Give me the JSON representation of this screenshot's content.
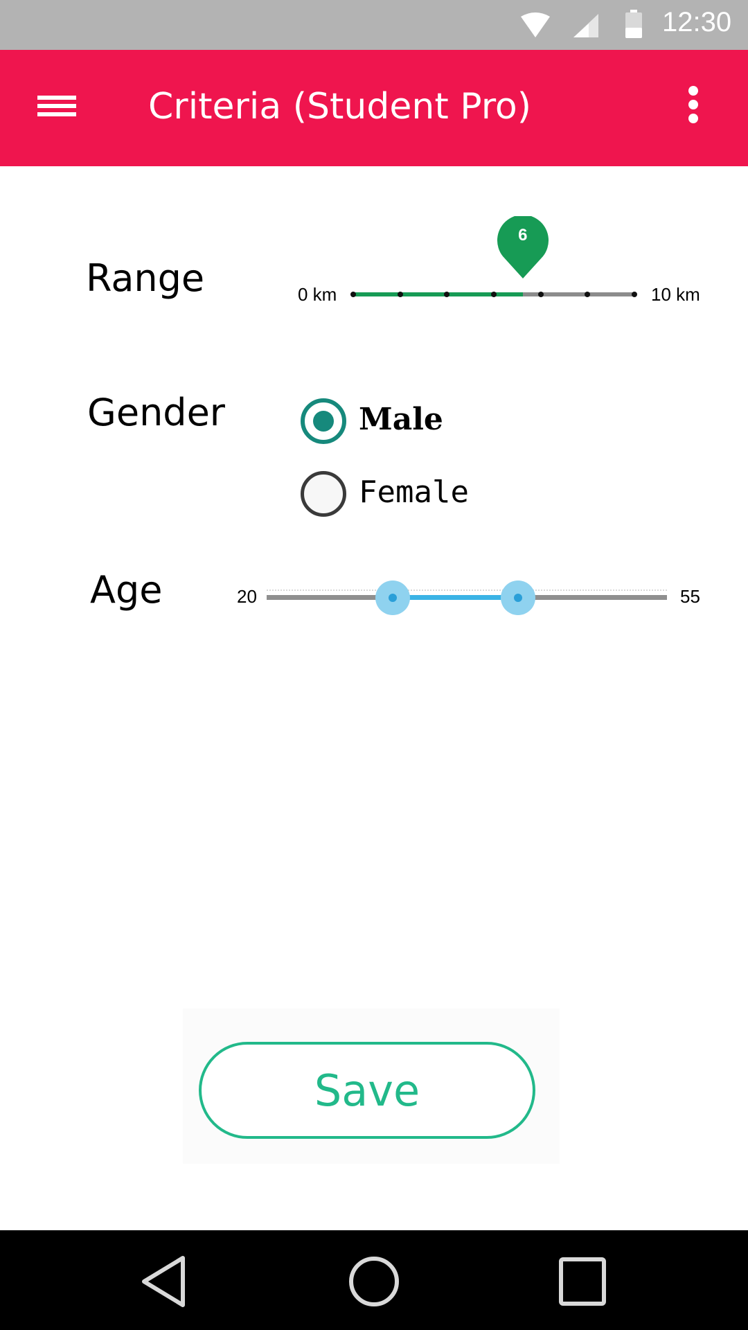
{
  "status_bar": {
    "time": "12:30",
    "icons": [
      "wifi-icon",
      "signal-icon",
      "battery-icon"
    ]
  },
  "app_bar": {
    "title": "Criteria (Student Pro)",
    "menu_icon": "hamburger-menu-icon",
    "overflow_icon": "more-vertical-icon",
    "color": "#ef154e"
  },
  "range": {
    "label": "Range",
    "min_label": "0 km",
    "max_label": "10 km",
    "value": "6",
    "fraction": 0.6,
    "steps": 6,
    "accent": "#179b55"
  },
  "gender": {
    "label": "Gender",
    "options": [
      {
        "label": "Male",
        "checked": true
      },
      {
        "label": "Female",
        "checked": false
      }
    ],
    "accent": "#16897c"
  },
  "age": {
    "label": "Age",
    "min_label": "20",
    "max_label": "55",
    "min": 20,
    "max": 55,
    "low": 31,
    "high": 42,
    "accent": "#3bb3e5"
  },
  "save": {
    "label": "Save",
    "color": "#22b98a"
  },
  "nav_bar": {
    "icons": [
      "back-icon",
      "home-icon",
      "recents-icon"
    ]
  }
}
